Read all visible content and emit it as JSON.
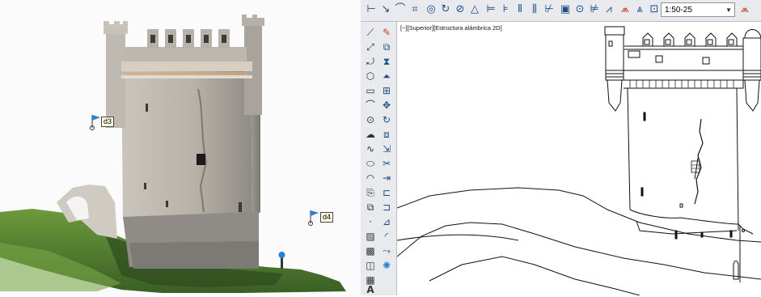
{
  "viewer": {
    "markers": [
      {
        "label": "d3"
      },
      {
        "label": "d4"
      }
    ]
  },
  "cad": {
    "viewport_label": "[−][Superior][Estructura alámbrica 2D]",
    "scale_value": "1:50-25",
    "toolbar_icons": [
      "line-icon",
      "polyline-icon",
      "pencil-icon",
      "chart-icon",
      "circle-icon",
      "arc-icon",
      "rotate-icon",
      "triangle-icon",
      "dimension-linear-icon",
      "dimension-aligned-icon",
      "dimension-angular-icon",
      "dimension-radius-icon",
      "dimension-ordinate-icon",
      "insert-block-icon",
      "target-icon",
      "grid-icon",
      "tangent-icon",
      "measure-icon",
      "triangle-measure-icon",
      "steps-icon"
    ],
    "side_icons_left": [
      "line-icon",
      "construction-line-icon",
      "polyline-icon",
      "polygon-icon",
      "rectangle-icon",
      "arc-icon",
      "circle-icon",
      "cloud-icon",
      "spline-icon",
      "ellipse-icon",
      "ellipse-arc-icon",
      "insert-block-icon",
      "make-block-icon",
      "point-icon",
      "hatch-icon",
      "gradient-icon",
      "region-icon",
      "table-icon",
      "text-icon",
      "add-selected-icon"
    ],
    "side_icons_right": [
      "erase-icon",
      "copy-icon",
      "mirror-icon",
      "offset-icon",
      "array-icon",
      "move-icon",
      "rotate-icon",
      "scale-icon",
      "stretch-icon",
      "trim-icon",
      "extend-icon",
      "break-icon",
      "join-icon",
      "chamfer-icon",
      "fillet-icon",
      "blend-icon",
      "explode-icon"
    ]
  }
}
